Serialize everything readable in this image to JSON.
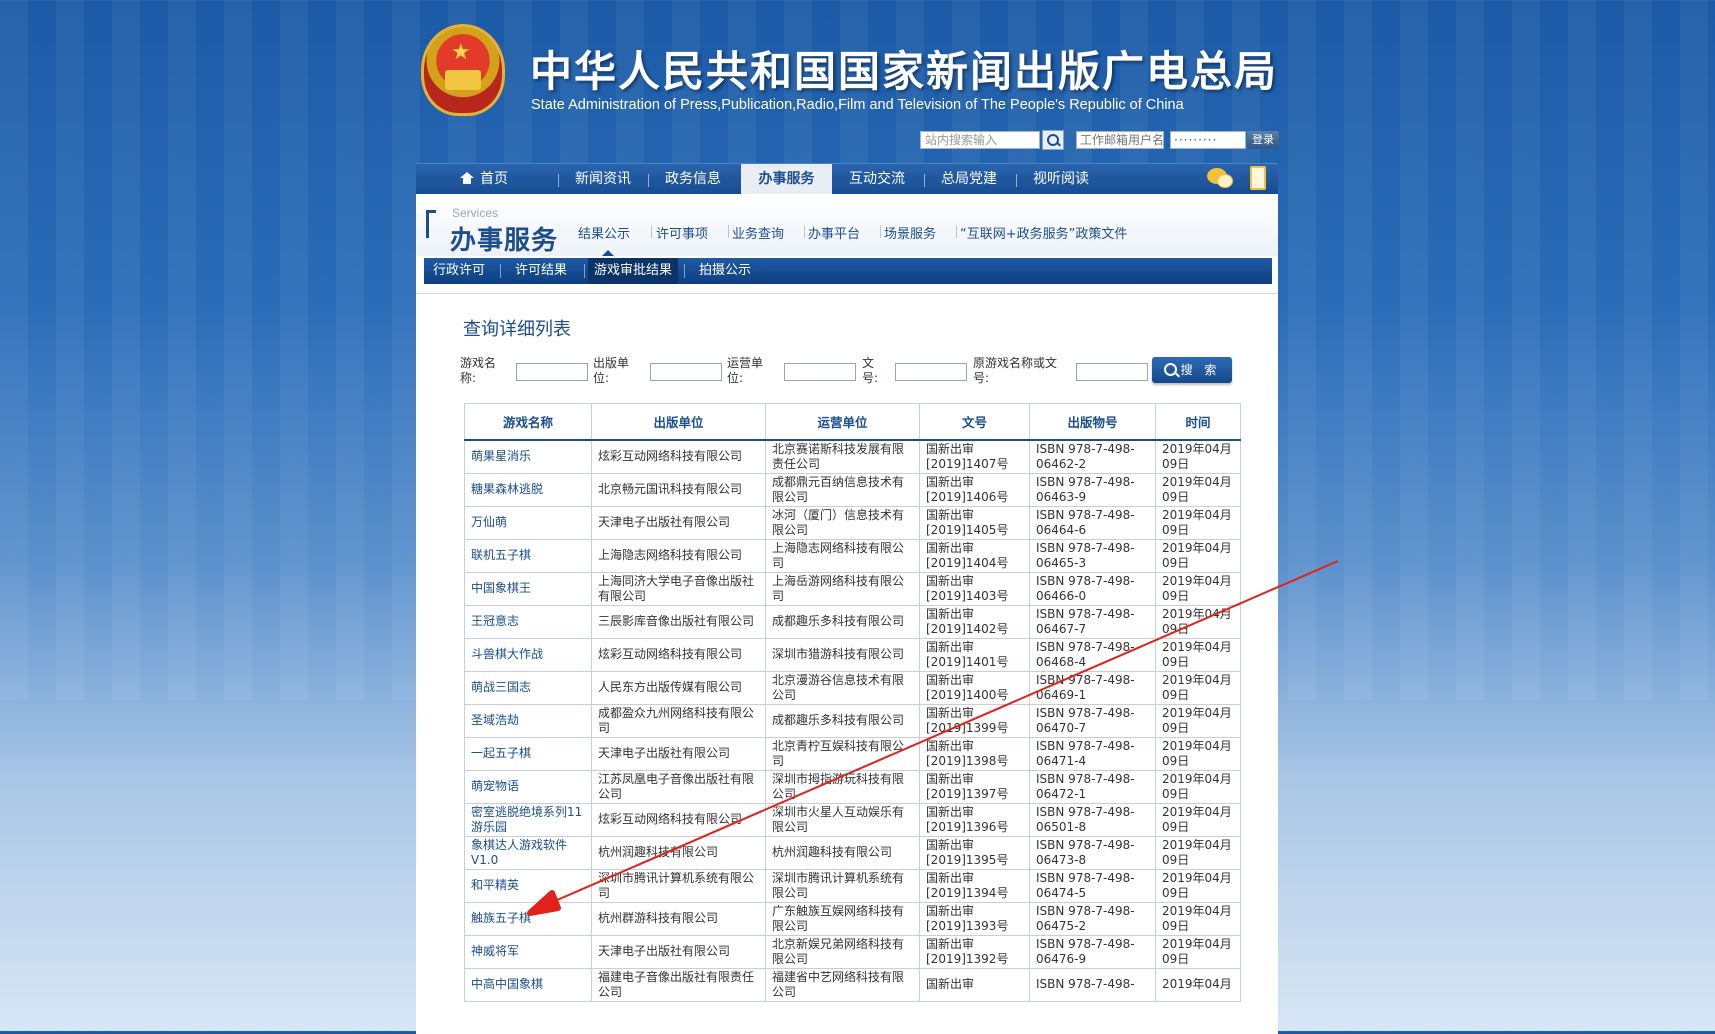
{
  "header": {
    "title": "中华人民共和国国家新闻出版广电总局",
    "subtitle": "State Administration of Press,Publication,Radio,Film and Television of The People's Republic of China",
    "emblem_icon": "national-emblem-icon",
    "site_search_placeholder": "站内搜索输入",
    "mail_user_placeholder": "工作邮箱用户名",
    "mail_password_mask": "·········",
    "login_label": "登录"
  },
  "nav": {
    "items": [
      "首页",
      "新闻资讯",
      "政务信息",
      "办事服务",
      "互动交流",
      "总局党建",
      "视听阅读"
    ],
    "active": "办事服务"
  },
  "section": {
    "en": "Services",
    "zh": "办事服务",
    "links": [
      "结果公示",
      "许可事项",
      "业务查询",
      "办事平台",
      "场景服务",
      "“互联网+政务服务”政策文件"
    ],
    "active_link": "结果公示"
  },
  "tabs": {
    "items": [
      "行政许可",
      "许可结果",
      "游戏审批结果",
      "拍摄公示"
    ],
    "active": "游戏审批结果"
  },
  "list_title": "查询详细列表",
  "filters": {
    "game_name": "游戏名称:",
    "publisher": "出版单位:",
    "operator": "运营单位:",
    "doc_no": "文号:",
    "original": "原游戏名称或文号:",
    "search_label": "搜 索"
  },
  "table": {
    "headers": [
      "游戏名称",
      "出版单位",
      "运营单位",
      "文号",
      "出版物号",
      "时间"
    ],
    "rows": [
      [
        "萌果星消乐",
        "炫彩互动网络科技有限公司",
        "北京赛诺斯科技发展有限责任公司",
        "国新出审[2019]1407号",
        "ISBN 978-7-498-06462-2",
        "2019年04月09日"
      ],
      [
        "糖果森林逃脱",
        "北京畅元国讯科技有限公司",
        "成都鼎元百纳信息技术有限公司",
        "国新出审[2019]1406号",
        "ISBN 978-7-498-06463-9",
        "2019年04月09日"
      ],
      [
        "万仙萌",
        "天津电子出版社有限公司",
        "冰河（厦门）信息技术有限公司",
        "国新出审[2019]1405号",
        "ISBN 978-7-498-06464-6",
        "2019年04月09日"
      ],
      [
        "联机五子棋",
        "上海隐志网络科技有限公司",
        "上海隐志网络科技有限公司",
        "国新出审[2019]1404号",
        "ISBN 978-7-498-06465-3",
        "2019年04月09日"
      ],
      [
        "中国象棋王",
        "上海同济大学电子音像出版社有限公司",
        "上海岳游网络科技有限公司",
        "国新出审[2019]1403号",
        "ISBN 978-7-498-06466-0",
        "2019年04月09日"
      ],
      [
        "王冠意志",
        "三辰影库音像出版社有限公司",
        "成都趣乐多科技有限公司",
        "国新出审[2019]1402号",
        "ISBN 978-7-498-06467-7",
        "2019年04月09日"
      ],
      [
        "斗兽棋大作战",
        "炫彩互动网络科技有限公司",
        "深圳市猎游科技有限公司",
        "国新出审[2019]1401号",
        "ISBN 978-7-498-06468-4",
        "2019年04月09日"
      ],
      [
        "萌战三国志",
        "人民东方出版传媒有限公司",
        "北京漫游谷信息技术有限公司",
        "国新出审[2019]1400号",
        "ISBN 978-7-498-06469-1",
        "2019年04月09日"
      ],
      [
        "圣域浩劫",
        "成都盈众九州网络科技有限公司",
        "成都趣乐多科技有限公司",
        "国新出审[2019]1399号",
        "ISBN 978-7-498-06470-7",
        "2019年04月09日"
      ],
      [
        "一起五子棋",
        "天津电子出版社有限公司",
        "北京青柠互娱科技有限公司",
        "国新出审[2019]1398号",
        "ISBN 978-7-498-06471-4",
        "2019年04月09日"
      ],
      [
        "萌宠物语",
        "江苏凤凰电子音像出版社有限公司",
        "深圳市拇指游玩科技有限公司",
        "国新出审[2019]1397号",
        "ISBN 978-7-498-06472-1",
        "2019年04月09日"
      ],
      [
        "密室逃脱绝境系列11游乐园",
        "炫彩互动网络科技有限公司",
        "深圳市火星人互动娱乐有限公司",
        "国新出审[2019]1396号",
        "ISBN 978-7-498-06501-8",
        "2019年04月09日"
      ],
      [
        "象棋达人游戏软件V1.0",
        "杭州润趣科技有限公司",
        "杭州润趣科技有限公司",
        "国新出审[2019]1395号",
        "ISBN 978-7-498-06473-8",
        "2019年04月09日"
      ],
      [
        "和平精英",
        "深圳市腾讯计算机系统有限公司",
        "深圳市腾讯计算机系统有限公司",
        "国新出审[2019]1394号",
        "ISBN 978-7-498-06474-5",
        "2019年04月09日"
      ],
      [
        "触族五子棋",
        "杭州群游科技有限公司",
        "广东触族互娱网络科技有限公司",
        "国新出审[2019]1393号",
        "ISBN 978-7-498-06475-2",
        "2019年04月09日"
      ],
      [
        "神威将军",
        "天津电子出版社有限公司",
        "北京新娱兄弟网络科技有限公司",
        "国新出审[2019]1392号",
        "ISBN 978-7-498-06476-9",
        "2019年04月09日"
      ],
      [
        "中高中国象棋",
        "福建电子音像出版社有限责任公司",
        "福建省中艺网络科技有限公司",
        "国新出审",
        "ISBN 978-7-498-",
        "2019年04月"
      ]
    ]
  },
  "annotation": {
    "arrow_color": "#e0221a"
  },
  "colors": {
    "brand_blue": "#1c4e8e",
    "nav_blue": "#1e5aa4"
  }
}
